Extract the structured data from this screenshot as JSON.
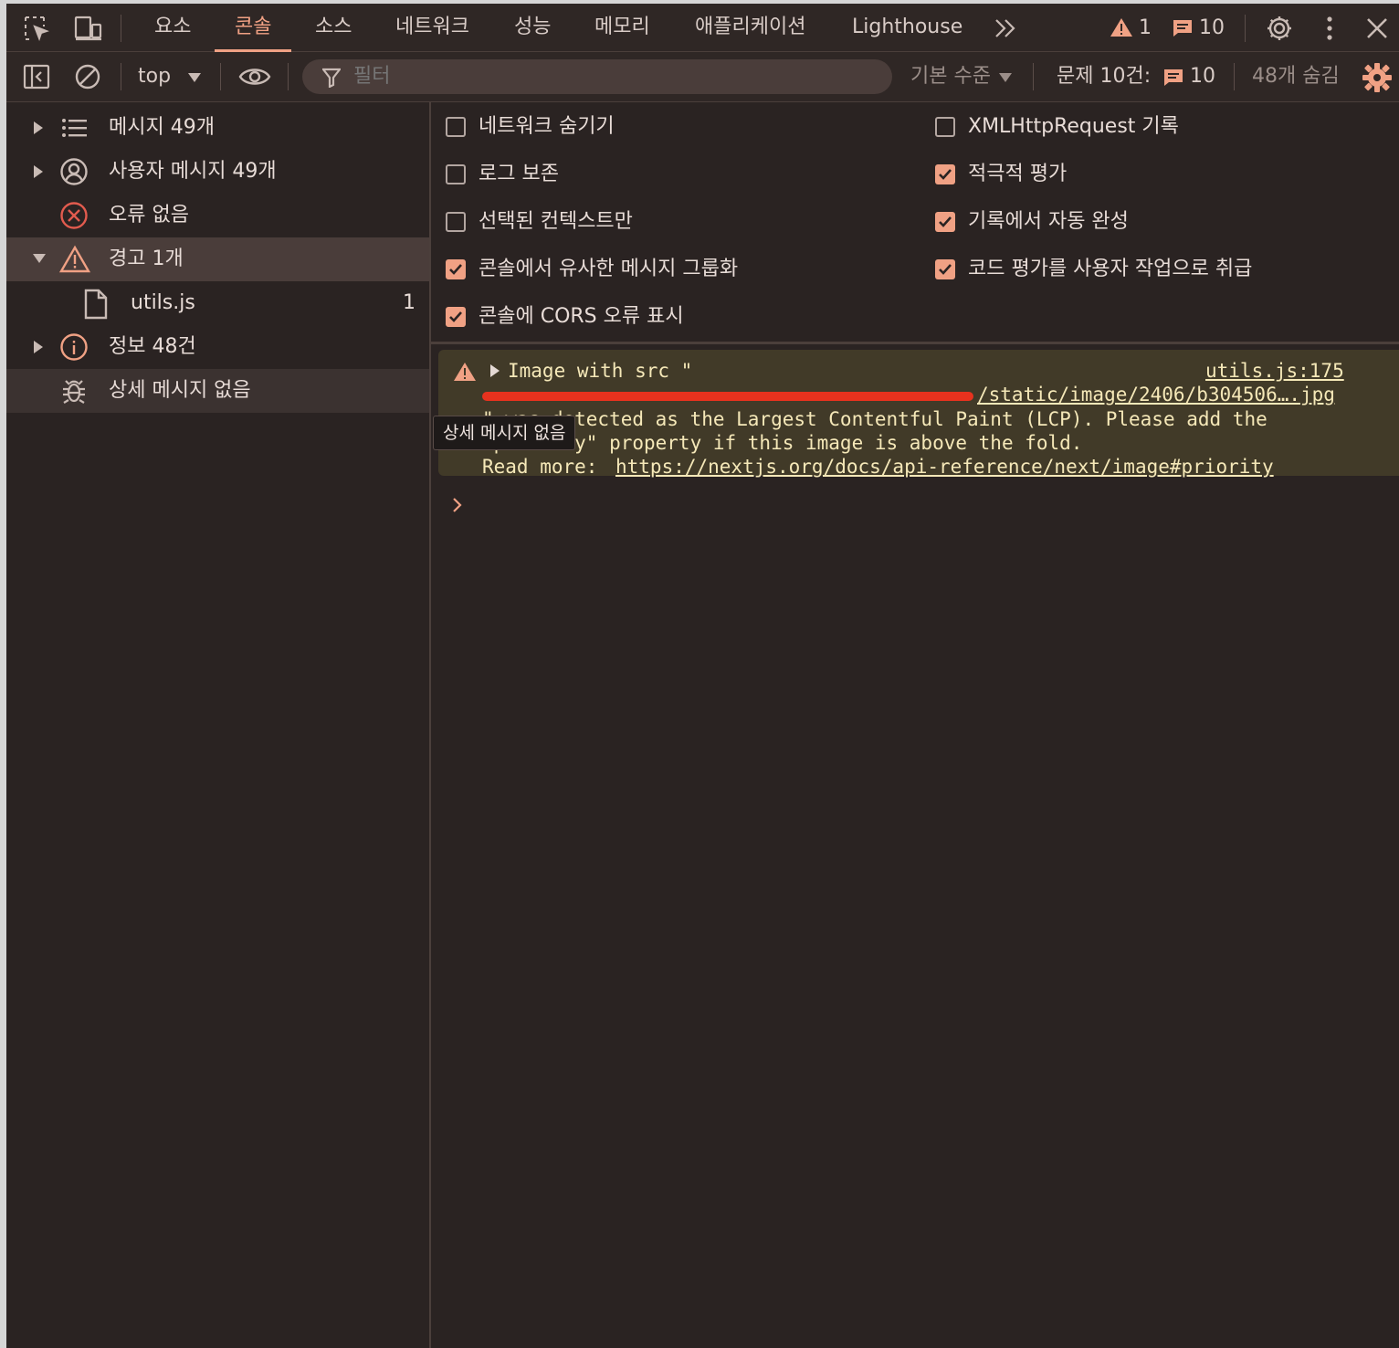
{
  "tabs": [
    {
      "label": "요소",
      "active": false
    },
    {
      "label": "콘솔",
      "active": true
    },
    {
      "label": "소스",
      "active": false
    },
    {
      "label": "네트워크",
      "active": false
    },
    {
      "label": "성능",
      "active": false
    },
    {
      "label": "메모리",
      "active": false
    },
    {
      "label": "애플리케이션",
      "active": false
    },
    {
      "label": "Lighthouse",
      "active": false
    }
  ],
  "counts": {
    "warnings": "1",
    "messages": "10"
  },
  "toolbar": {
    "context": "top",
    "filter_placeholder": "필터",
    "level": "기본 수준",
    "issues_label": "문제 10건:",
    "issues_count": "10",
    "hidden": "48개 숨김"
  },
  "sidebar": {
    "items": [
      {
        "label": "메시지 49개",
        "icon": "list-icon"
      },
      {
        "label": "사용자 메시지 49개",
        "icon": "user-icon"
      },
      {
        "label": "오류 없음",
        "icon": "error-icon"
      },
      {
        "label": "경고 1개",
        "icon": "warning-icon"
      },
      {
        "label": "utils.js",
        "count": "1",
        "icon": "file-icon"
      },
      {
        "label": "정보 48건",
        "icon": "info-icon"
      },
      {
        "label": "상세 메시지 없음",
        "icon": "bug-icon"
      }
    ]
  },
  "settings": {
    "left": [
      {
        "label": "네트워크 숨기기",
        "checked": false
      },
      {
        "label": "로그 보존",
        "checked": false
      },
      {
        "label": "선택된 컨텍스트만",
        "checked": false
      },
      {
        "label": "콘솔에서 유사한 메시지 그룹화",
        "checked": true
      },
      {
        "label": "콘솔에 CORS 오류 표시",
        "checked": true
      }
    ],
    "right": [
      {
        "label": "XMLHttpRequest 기록",
        "checked": false
      },
      {
        "label": "적극적 평가",
        "checked": true
      },
      {
        "label": "기록에서 자동 완성",
        "checked": true
      },
      {
        "label": "코드 평가를 사용자 작업으로 취급",
        "checked": true
      }
    ]
  },
  "console": {
    "warning": {
      "line1": "Image with src \"",
      "source": "utils.js:175",
      "url_visible": "/static/image/2406/b304506….jpg",
      "line3": "\" was detected as the Largest Contentful Paint (LCP). Please add the",
      "line4": "\"priority\" property if this image is above the fold.",
      "read_more": "Read more: ",
      "link": "https://nextjs.org/docs/api-reference/next/image#priority"
    }
  },
  "tooltip": "상세 메시지 없음",
  "colors": {
    "background": "#2a2322",
    "accent": "#f0a184",
    "warning_bg": "#413a28",
    "warning_text": "#f5e8b8",
    "error": "#e25b4e",
    "redaction": "#e8321e"
  }
}
